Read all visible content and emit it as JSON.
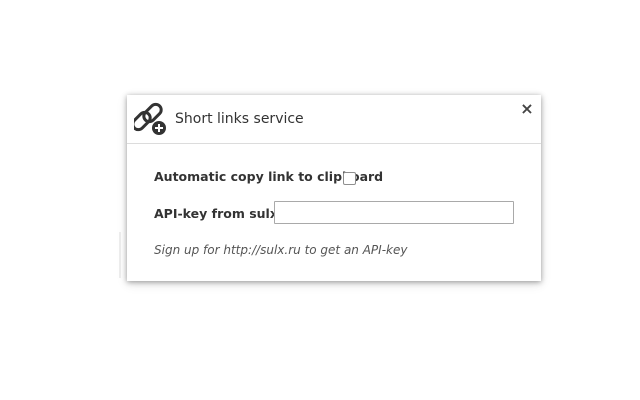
{
  "dialog": {
    "title": "Short links service",
    "logo_icon": "chain-link-add-icon",
    "close_label": "×"
  },
  "settings": {
    "auto_copy_label": "Automatic copy link to clipboard",
    "auto_copy_checked": false,
    "api_key_label": "API-key from sulx.ru",
    "api_key_value": "",
    "signup_note": "Sign up for http://sulx.ru to get an API-key"
  },
  "colors": {
    "title_text": "#333333",
    "label_text": "#333333",
    "note_text": "#555555",
    "divider": "#dcdcdc",
    "icon": "#333333"
  }
}
